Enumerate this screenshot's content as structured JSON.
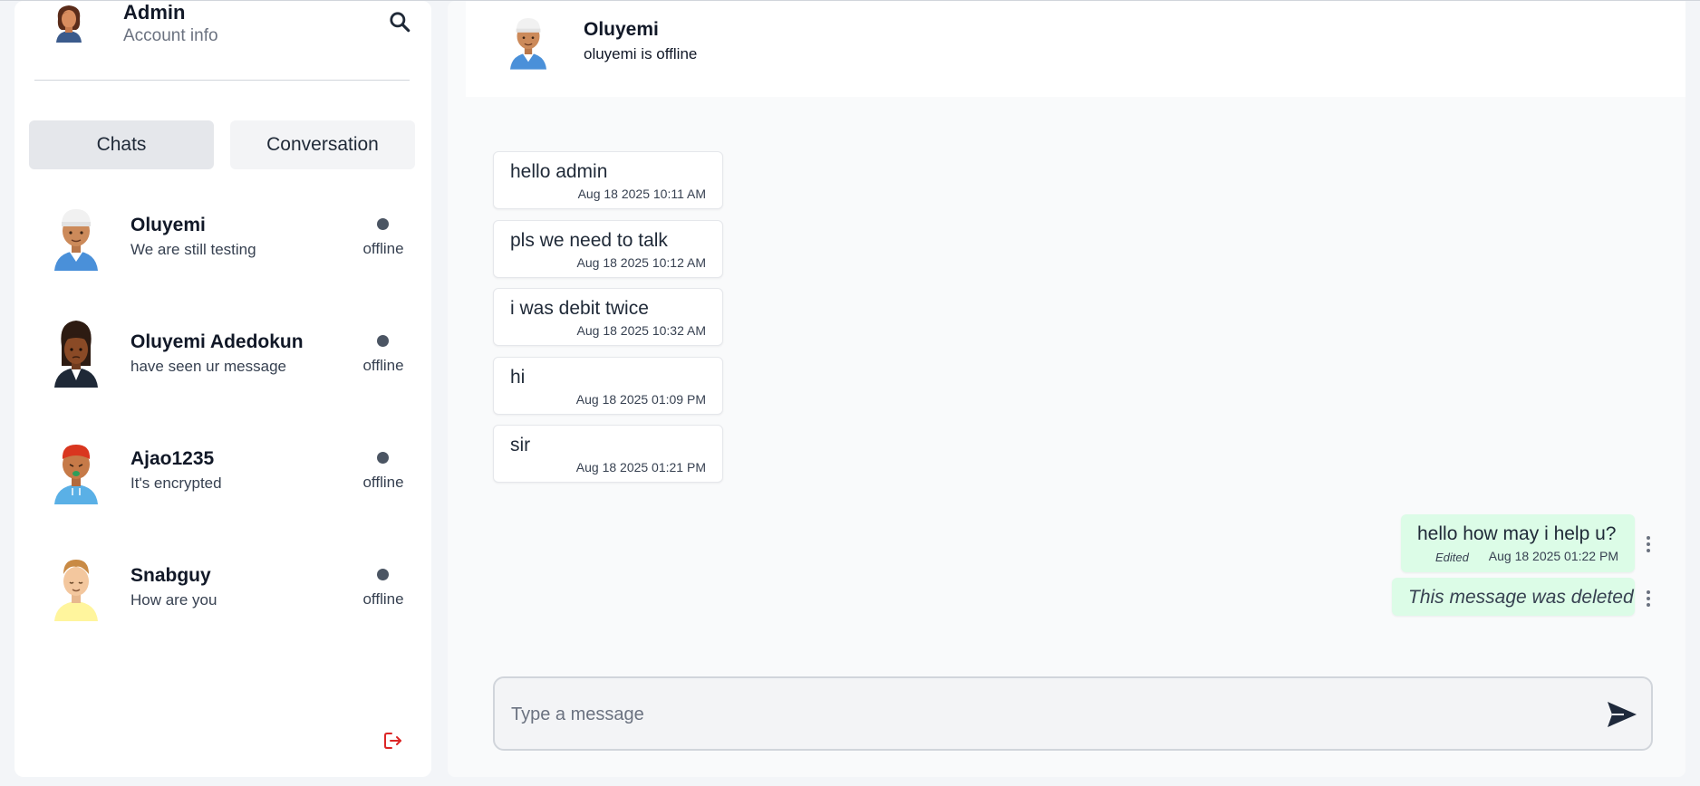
{
  "account": {
    "name": "Admin",
    "subtitle": "Account info"
  },
  "tabs": [
    {
      "label": "Chats",
      "active": true
    },
    {
      "label": "Conversation",
      "active": false
    }
  ],
  "chats": [
    {
      "name": "Oluyemi",
      "preview": "We are still testing",
      "status": "offline",
      "avatar": "avatar-white-cap"
    },
    {
      "name": "Oluyemi Adedokun",
      "preview": "have seen ur message",
      "status": "offline",
      "avatar": "avatar-dark-hair"
    },
    {
      "name": "Ajao1235",
      "preview": "It's encrypted",
      "status": "offline",
      "avatar": "avatar-red-hair"
    },
    {
      "name": "Snabguy",
      "preview": "How are you",
      "status": "offline",
      "avatar": "avatar-blonde"
    }
  ],
  "conversation": {
    "contact_name": "Oluyemi",
    "contact_status": "oluyemi is offline",
    "incoming": [
      {
        "text": "hello admin",
        "time": "Aug 18 2025 10:11 AM"
      },
      {
        "text": "pls we need to talk",
        "time": "Aug 18 2025 10:12 AM"
      },
      {
        "text": "i was debit twice",
        "time": "Aug 18 2025 10:32 AM"
      },
      {
        "text": "hi",
        "time": "Aug 18 2025 01:09 PM"
      },
      {
        "text": "sir",
        "time": "Aug 18 2025 01:21 PM"
      }
    ],
    "outgoing": [
      {
        "text": "hello how may i help u?",
        "edited_label": "Edited",
        "time": "Aug 18 2025 01:22 PM"
      },
      {
        "text": "This message was deleted"
      }
    ]
  },
  "composer": {
    "placeholder": "Type a message"
  },
  "colors": {
    "outgoing_bubble": "#dcfce7",
    "logout_icon": "#dc2626",
    "send_icon": "#1e293b"
  },
  "icons": [
    "search-icon",
    "logout-icon",
    "send-icon",
    "more-vertical-icon"
  ]
}
